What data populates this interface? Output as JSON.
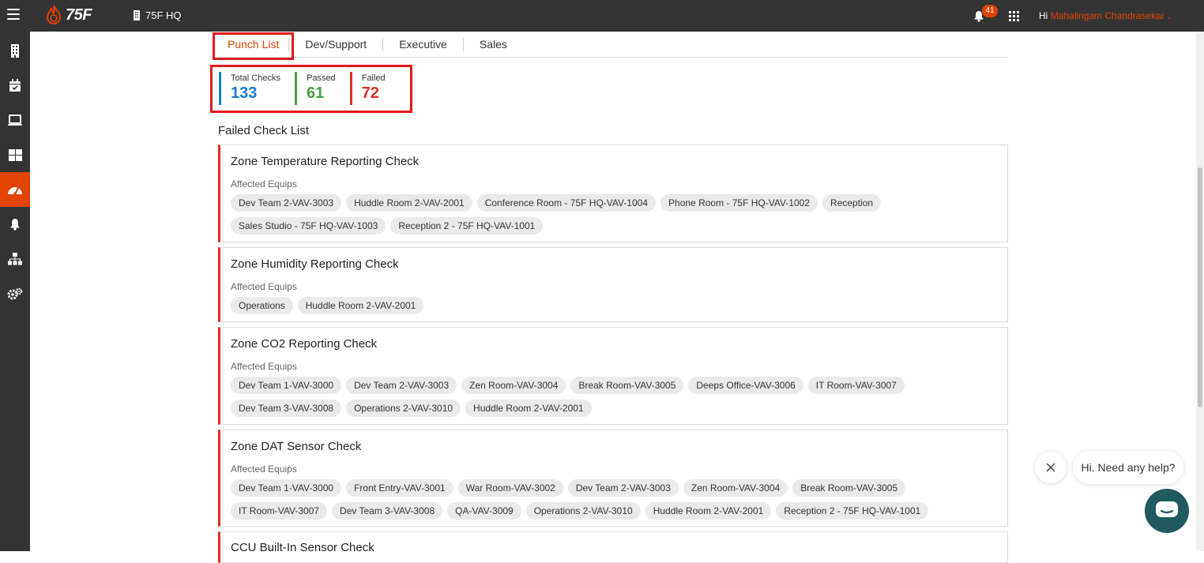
{
  "header": {
    "brand": "75F",
    "site_name": "75F HQ",
    "notification_count": "41",
    "greeting_prefix": "Hi",
    "user_name": "Mahalingam Chandrasekar"
  },
  "tabs": [
    {
      "label": "Punch List",
      "active": true
    },
    {
      "label": "Dev/Support",
      "active": false
    },
    {
      "label": "Executive",
      "active": false
    },
    {
      "label": "Sales",
      "active": false
    }
  ],
  "summary": {
    "total": {
      "label": "Total Checks",
      "value": "133",
      "color": "#1a7ad2"
    },
    "passed": {
      "label": "Passed",
      "value": "61",
      "color": "#43a047"
    },
    "failed": {
      "label": "Failed",
      "value": "72",
      "color": "#e0311f"
    }
  },
  "failed_list_title": "Failed Check List",
  "affected_label": "Affected Equips",
  "checks": [
    {
      "title": "Zone Temperature Reporting Check",
      "equips": [
        "Dev Team 2-VAV-3003",
        "Huddle Room 2-VAV-2001",
        "Conference Room - 75F HQ-VAV-1004",
        "Phone Room - 75F HQ-VAV-1002",
        "Reception",
        "Sales Studio - 75F HQ-VAV-1003",
        "Reception 2 - 75F HQ-VAV-1001"
      ]
    },
    {
      "title": "Zone Humidity Reporting Check",
      "equips": [
        "Operations",
        "Huddle Room 2-VAV-2001"
      ]
    },
    {
      "title": "Zone CO2 Reporting Check",
      "equips": [
        "Dev Team 1-VAV-3000",
        "Dev Team 2-VAV-3003",
        "Zen Room-VAV-3004",
        "Break Room-VAV-3005",
        "Deeps Office-VAV-3006",
        "IT Room-VAV-3007",
        "Dev Team 3-VAV-3008",
        "Operations 2-VAV-3010",
        "Huddle Room 2-VAV-2001"
      ]
    },
    {
      "title": "Zone DAT Sensor Check",
      "equips": [
        "Dev Team 1-VAV-3000",
        "Front Entry-VAV-3001",
        "War Room-VAV-3002",
        "Dev Team 2-VAV-3003",
        "Zen Room-VAV-3004",
        "Break Room-VAV-3005",
        "IT Room-VAV-3007",
        "Dev Team 3-VAV-3008",
        "QA-VAV-3009",
        "Operations 2-VAV-3010",
        "Huddle Room 2-VAV-2001",
        "Reception 2 - 75F HQ-VAV-1001"
      ]
    },
    {
      "title": "CCU Built-In Sensor Check",
      "equips": []
    }
  ],
  "help": {
    "message": "Hi. Need any help?"
  },
  "sidebar": [
    "building-icon",
    "calendar-check-icon",
    "laptop-icon",
    "dashboard-icon",
    "gauge-icon",
    "bell-icon",
    "hierarchy-icon",
    "settings-icon"
  ]
}
